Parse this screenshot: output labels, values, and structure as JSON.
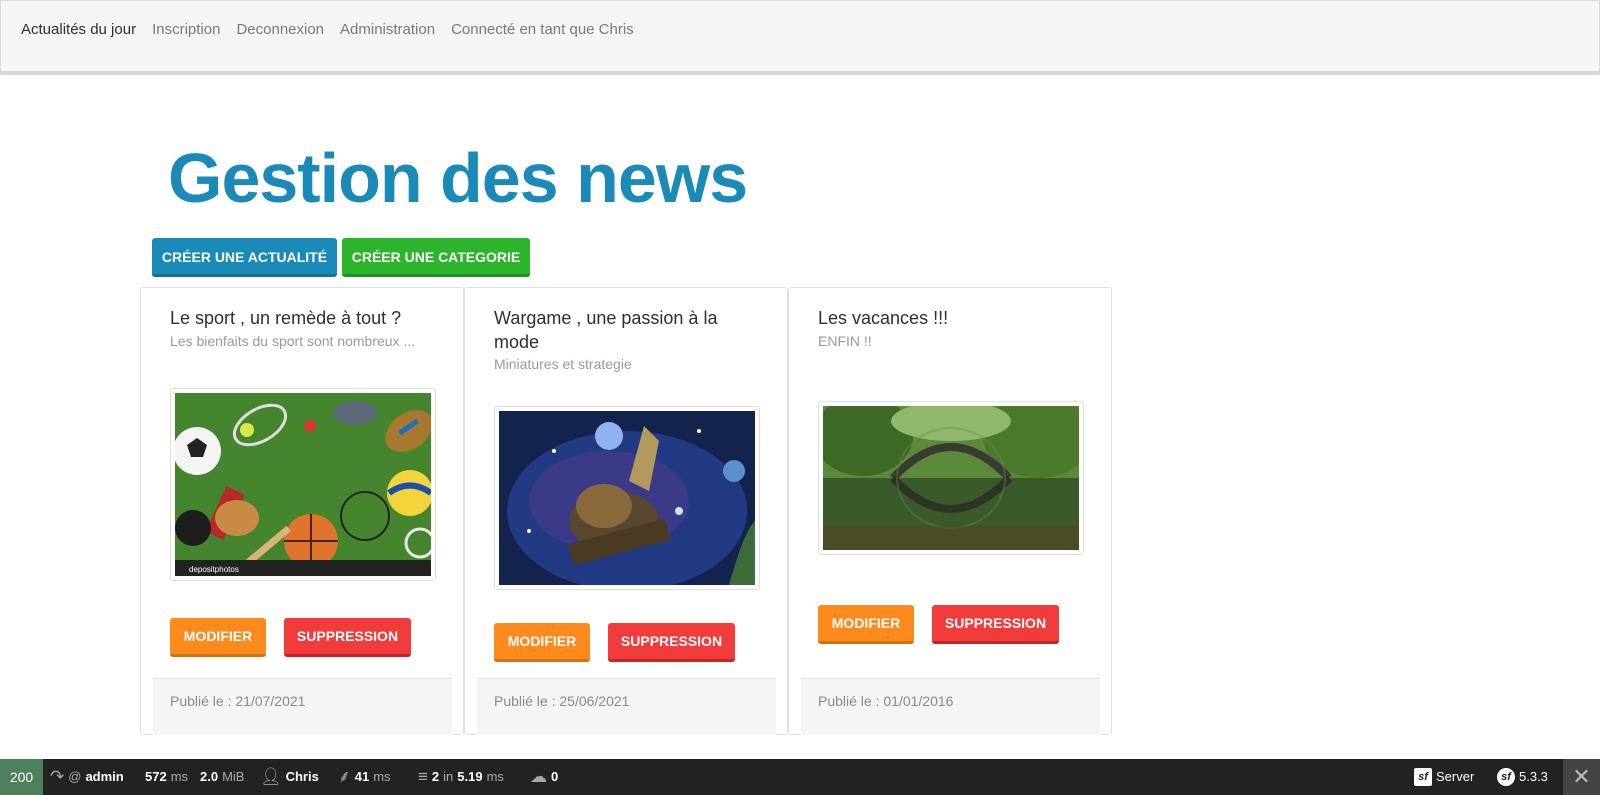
{
  "nav": {
    "items": [
      {
        "label": "Actualités du jour",
        "active": true
      },
      {
        "label": "Inscription",
        "active": false
      },
      {
        "label": "Deconnexion",
        "active": false
      },
      {
        "label": "Administration",
        "active": false
      },
      {
        "label": "Connecté en tant que Chris",
        "active": false
      }
    ]
  },
  "page": {
    "title": "Gestion des news",
    "create_news_label": "Créer une actualité",
    "create_category_label": "Créer une categorie"
  },
  "news": [
    {
      "title": "Le sport , un remède à tout ?",
      "subtitle": "Les bienfaits du sport sont nombreux ...",
      "image": "sports-equipment-image",
      "modify_label": "Modifier",
      "delete_label": "Suppression",
      "published": "Publié le : 21/07/2021"
    },
    {
      "title": "Wargame , une passion à la mode",
      "subtitle": "Miniatures et strategie",
      "image": "space-fantasy-image",
      "modify_label": "Modifier",
      "delete_label": "Suppression",
      "published": "Publié le : 25/06/2021"
    },
    {
      "title": "Les vacances !!!",
      "subtitle": "ENFIN !!",
      "image": "forest-bridge-image",
      "modify_label": "Modifier",
      "delete_label": "Suppression",
      "published": "Publié le : 01/01/2016"
    }
  ],
  "toolbar": {
    "status": "200",
    "route_at": "@",
    "route": "admin",
    "time_value": "572",
    "time_unit": "ms",
    "memory_value": "2.0",
    "memory_unit": "MiB",
    "user": "Chris",
    "twig_value": "41",
    "twig_unit": "ms",
    "db_queries": "2",
    "db_in": "in",
    "db_time": "5.19",
    "db_unit": "ms",
    "uploads": "0",
    "server_label": "Server",
    "version": "5.3.3",
    "colors": {
      "background": "#222222",
      "status_ok": "#4f805d"
    }
  },
  "colors": {
    "primary": "#1a8ab8",
    "success": "#2cb52c",
    "warning": "#fd8a1d",
    "danger": "#f23c3c"
  }
}
